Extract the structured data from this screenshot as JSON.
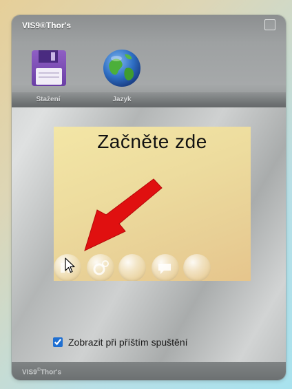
{
  "window": {
    "title": "VIS9®Thor's",
    "footer_brand": "VIS9",
    "footer_mark": "©",
    "footer_name": "Thor's"
  },
  "toolbar": {
    "items": [
      {
        "label": "Stažení",
        "icon": "floppy-disk-icon"
      },
      {
        "label": "Jazyk",
        "icon": "globe-icon"
      }
    ]
  },
  "start_panel": {
    "title": "Začněte zde",
    "bubbles": [
      "play-bubble",
      "gears-bubble",
      "blank-bubble",
      "chat-bubble",
      "blank-bubble"
    ]
  },
  "startup": {
    "label": "Zobrazit při příštím spuštění",
    "checked": true
  },
  "colors": {
    "arrow": "#e01010",
    "checkbox": "#1f6fd1",
    "title_text": "#ffffff"
  }
}
